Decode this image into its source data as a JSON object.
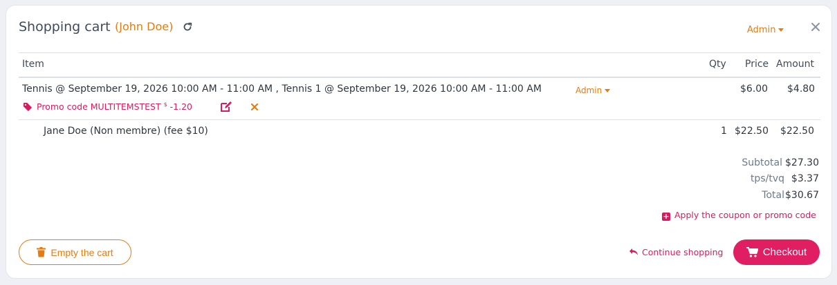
{
  "header": {
    "title": "Shopping cart",
    "customer": "(John Doe)",
    "admin_menu": "Admin"
  },
  "columns": {
    "item": "Item",
    "qty": "Qty",
    "price": "Price",
    "amount": "Amount"
  },
  "line_item": {
    "description": "Tennis @ September 19, 2026 10:00 AM - 11:00 AM , Tennis 1 @ September 19, 2026 10:00 AM - 11:00 AM",
    "admin_menu": "Admin",
    "price": "$6.00",
    "amount": "$4.80",
    "promo_label": "Promo code MULTITEMSTEST",
    "promo_currency": "$",
    "promo_value": "-1.20"
  },
  "participant": {
    "name": "Jane Doe (Non membre) (fee $10)",
    "qty": "1",
    "price": "$22.50",
    "amount": "$22.50"
  },
  "totals": [
    {
      "label": "Subtotal",
      "value": "$27.30"
    },
    {
      "label": "tps/tvq",
      "value": "$3.37"
    },
    {
      "label": "Total",
      "value": "$30.67"
    }
  ],
  "actions": {
    "apply_coupon": "Apply the coupon or promo code",
    "empty_cart": "Empty the cart",
    "continue_shopping": "Continue shopping",
    "checkout": "Checkout"
  },
  "colors": {
    "accent_orange": "#e57c0f",
    "accent_pink": "#df1f62"
  }
}
